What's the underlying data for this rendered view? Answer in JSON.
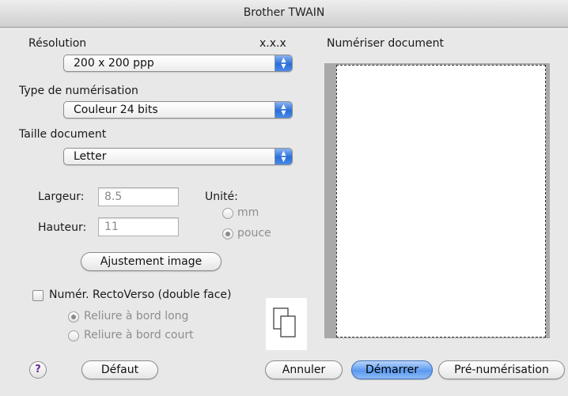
{
  "window": {
    "title": "Brother TWAIN"
  },
  "resolution": {
    "label": "Résolution",
    "version": "x.x.x",
    "value": "200 x 200 ppp"
  },
  "scan_type": {
    "label": "Type de numérisation",
    "value": "Couleur 24 bits"
  },
  "doc_size": {
    "label": "Taille document",
    "value": "Letter"
  },
  "width_field": {
    "label": "Largeur:",
    "value": "8.5"
  },
  "height_field": {
    "label": "Hauteur:",
    "value": "11"
  },
  "unit": {
    "label": "Unité:",
    "options": [
      "mm",
      "pouce"
    ],
    "selected": "pouce"
  },
  "adjust_button": "Ajustement image",
  "duplex": {
    "label": "Numér. RectoVerso (double face)",
    "checked": false,
    "options": [
      "Reliure à bord long",
      "Reliure à bord court"
    ],
    "selected": "Reliure à bord long"
  },
  "preview": {
    "label": "Numériser document"
  },
  "buttons": {
    "help": "?",
    "default": "Défaut",
    "cancel": "Annuler",
    "start": "Démarrer",
    "prescan": "Pré-numérisation"
  },
  "icons": {
    "popup_arrows": "up-down-arrows-icon",
    "page_layout": "two-pages-icon"
  },
  "colors": {
    "accent": "#2a6fd8",
    "help_mark": "#6a2a9a"
  }
}
